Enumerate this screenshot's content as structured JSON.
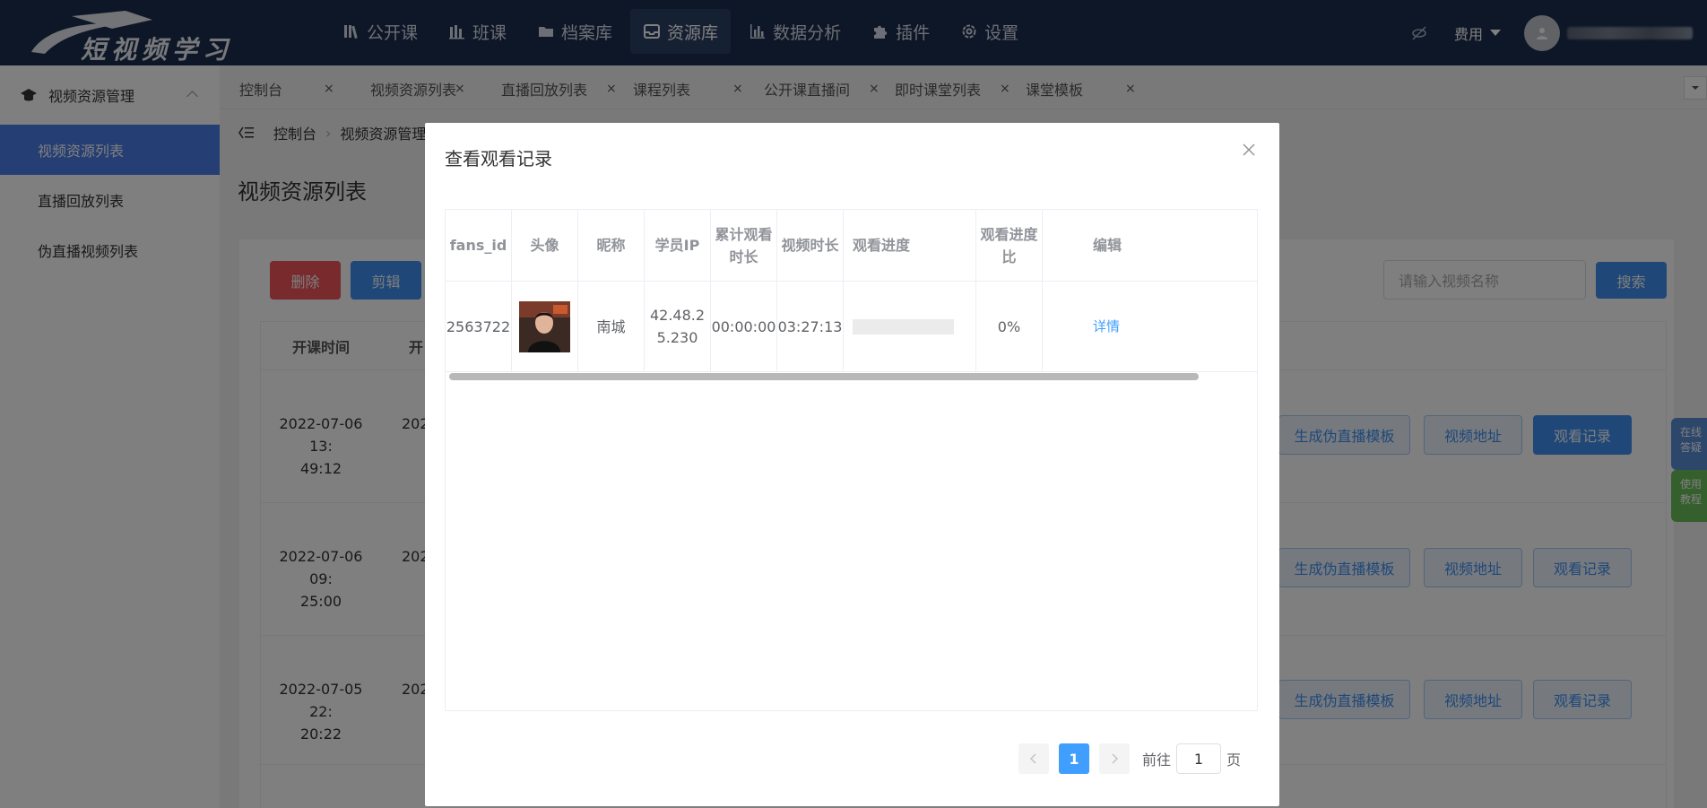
{
  "header": {
    "logo_text": "短视频学习",
    "nav": [
      {
        "label": "公开课",
        "icon": "library-icon"
      },
      {
        "label": "班课",
        "icon": "bars-icon"
      },
      {
        "label": "档案库",
        "icon": "folder-icon"
      },
      {
        "label": "资源库",
        "icon": "inbox-icon",
        "active": true
      },
      {
        "label": "数据分析",
        "icon": "chart-icon"
      },
      {
        "label": "插件",
        "icon": "puzzle-icon"
      },
      {
        "label": "设置",
        "icon": "gear-icon"
      }
    ],
    "fee_label": "费用"
  },
  "sidebar": {
    "group_label": "视频资源管理",
    "items": [
      {
        "label": "视频资源列表",
        "active": true
      },
      {
        "label": "直播回放列表"
      },
      {
        "label": "伪直播视频列表"
      }
    ]
  },
  "tabs": [
    "控制台",
    "视频资源列表",
    "直播回放列表",
    "课程列表",
    "公开课直播间",
    "即时课堂列表",
    "课堂模板"
  ],
  "breadcrumb": {
    "home": "控制台",
    "current": "视频资源管理"
  },
  "page_title": "视频资源列表",
  "toolbar": {
    "delete_label": "删除",
    "edit_label": "剪辑",
    "search_placeholder": "请输入视频名称",
    "search_label": "搜索"
  },
  "bg_table": {
    "headers": [
      "开课时间",
      "开"
    ],
    "rows": [
      {
        "time": "2022-07-06 13:49:12",
        "time_line1": "2022-07-06 13:",
        "time_line2": "49:12",
        "col2": "202"
      },
      {
        "time": "2022-07-06 09:25:00",
        "time_line1": "2022-07-06 09:",
        "time_line2": "25:00",
        "col2": "202"
      },
      {
        "time": "2022-07-05 22:20:22",
        "time_line1": "2022-07-05 22:",
        "time_line2": "20:22",
        "col2": "202"
      }
    ],
    "action_gen": "生成伪直播模板",
    "action_url": "视频地址",
    "action_record": "观看记录"
  },
  "floating": {
    "online": "在线答疑",
    "tutorial": "使用教程"
  },
  "modal": {
    "title": "查看观看记录",
    "columns": [
      "fans_id",
      "头像",
      "昵称",
      "学员IP",
      "累计观看时长",
      "视频时长",
      "观看进度",
      "观看进度比",
      "编辑"
    ],
    "column_lines": {
      "cum_1": "累计观看",
      "cum_2": "时长",
      "ratio_1": "观看进度",
      "ratio_2": "比"
    },
    "rows": [
      {
        "fans_id": "2563722",
        "nickname": "南城",
        "ip": "42.48.25.230",
        "ip_line1": "42.48.2",
        "ip_line2": "5.230",
        "cumulative": "00:00:00",
        "duration": "03:27:13",
        "progress": 0,
        "ratio": "0%",
        "edit": "详情"
      }
    ],
    "pager": {
      "current": "1",
      "goto_label": "前往",
      "goto_value": "1",
      "page_label": "页"
    }
  },
  "colors": {
    "topbar": "#1c2e4f",
    "accent": "#3f8ff0",
    "sidebar_active": "#4b7ce6",
    "danger": "#f0545a"
  }
}
